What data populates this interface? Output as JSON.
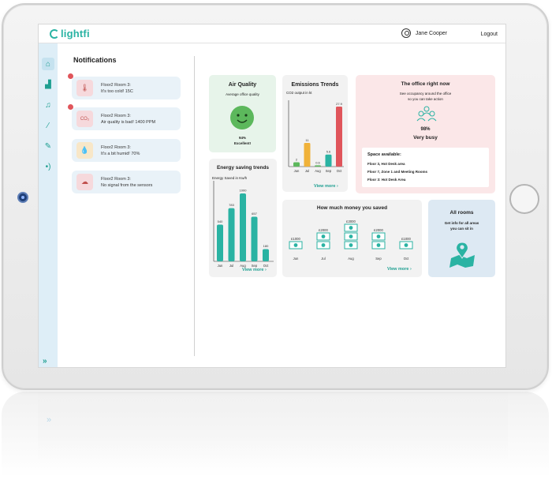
{
  "app": {
    "logo": "lightfi"
  },
  "topbar": {
    "user_name": "Jane Cooper",
    "logout": "Logout"
  },
  "sidebar": {
    "items": [
      {
        "icon": "home-icon",
        "glyph": "⌂",
        "active": true
      },
      {
        "icon": "building-icon",
        "glyph": "▟"
      },
      {
        "icon": "bell-icon",
        "glyph": "♫"
      },
      {
        "icon": "chart-icon",
        "glyph": "⁄"
      },
      {
        "icon": "wrench-icon",
        "glyph": "✎"
      },
      {
        "icon": "sensor-icon",
        "glyph": "•)"
      }
    ],
    "expand": "»"
  },
  "notifications": {
    "title": "Notifications",
    "items": [
      {
        "line1": "Floor2 Room 3:",
        "line2": "It's too cold! 15C",
        "icon": "thermometer-icon",
        "unread": true,
        "color": "#f6d9dc"
      },
      {
        "line1": "Floor2 Room 3:",
        "line2": "Air quality is bad! 1400 PPM",
        "icon": "co2-icon",
        "unread": true,
        "color": "#f6d9dc"
      },
      {
        "line1": "Floor2 Room 3:",
        "line2": "It's a bit humid! 70%",
        "icon": "droplet-icon",
        "unread": false,
        "color": "#f8e7c8"
      },
      {
        "line1": "Floor2 Room 3:",
        "line2": "No signal from the sensors",
        "icon": "no-signal-icon",
        "unread": false,
        "color": "#f6d9dc"
      }
    ]
  },
  "air_quality": {
    "title": "Air Quality",
    "subtitle": "Average office quality",
    "value": "94%",
    "status": "Excellent!"
  },
  "emissions": {
    "title": "Emissions Trends",
    "view_more": "View more",
    "chart_data": {
      "type": "bar",
      "ylabel": "CO2 output in kt",
      "categories": [
        "Jun",
        "Jul",
        "Aug",
        "Sep",
        "Oct"
      ],
      "values": [
        2,
        11,
        0.6,
        5.6,
        27.9
      ],
      "value_labels": [
        "2",
        "11",
        "0.6",
        "5.6",
        "27.9"
      ],
      "colors": [
        "#5cb85c",
        "#f0b23a",
        "#5cb85c",
        "#2ab3a3",
        "#e0555b"
      ]
    }
  },
  "occupancy": {
    "title": "The office right now",
    "subtitle1": "See occupancy around the office",
    "subtitle2": "so you can take action",
    "value": "98%",
    "status": "Very busy",
    "space_title": "Space available:",
    "spaces": [
      "Floor 3, Hot Desk area",
      "Floor 7, Zone 1 and Meeting Rooms",
      "Floor 3: Hot Desk Area"
    ]
  },
  "energy": {
    "title": "Energy saving trends",
    "view_more": "View more",
    "chart_data": {
      "type": "bar",
      "ylabel": "Energy Saved in Kw/h",
      "categories": [
        "Jun",
        "Jul",
        "Aug",
        "Sep",
        "Oct"
      ],
      "values": [
        540,
        783,
        1000,
        657,
        180
      ],
      "value_labels": [
        "540",
        "783",
        "1000",
        "657",
        "180"
      ],
      "color": "#2ab3a3"
    }
  },
  "money": {
    "title": "How much money you saved",
    "view_more": "View more",
    "chart_data": {
      "type": "bar",
      "categories": [
        "Jun",
        "Jul",
        "Aug",
        "Sep",
        "Oct"
      ],
      "values": [
        1000,
        2000,
        3000,
        2000,
        1000
      ],
      "value_labels": [
        "£1000",
        "£2000",
        "£3000",
        "£2000",
        "£1000"
      ],
      "color": "#2ab3a3"
    }
  },
  "all_rooms": {
    "title": "All rooms",
    "subtitle1": "Get info for all areas",
    "subtitle2": "you can sit in"
  },
  "reflection": {
    "expand": "»"
  }
}
